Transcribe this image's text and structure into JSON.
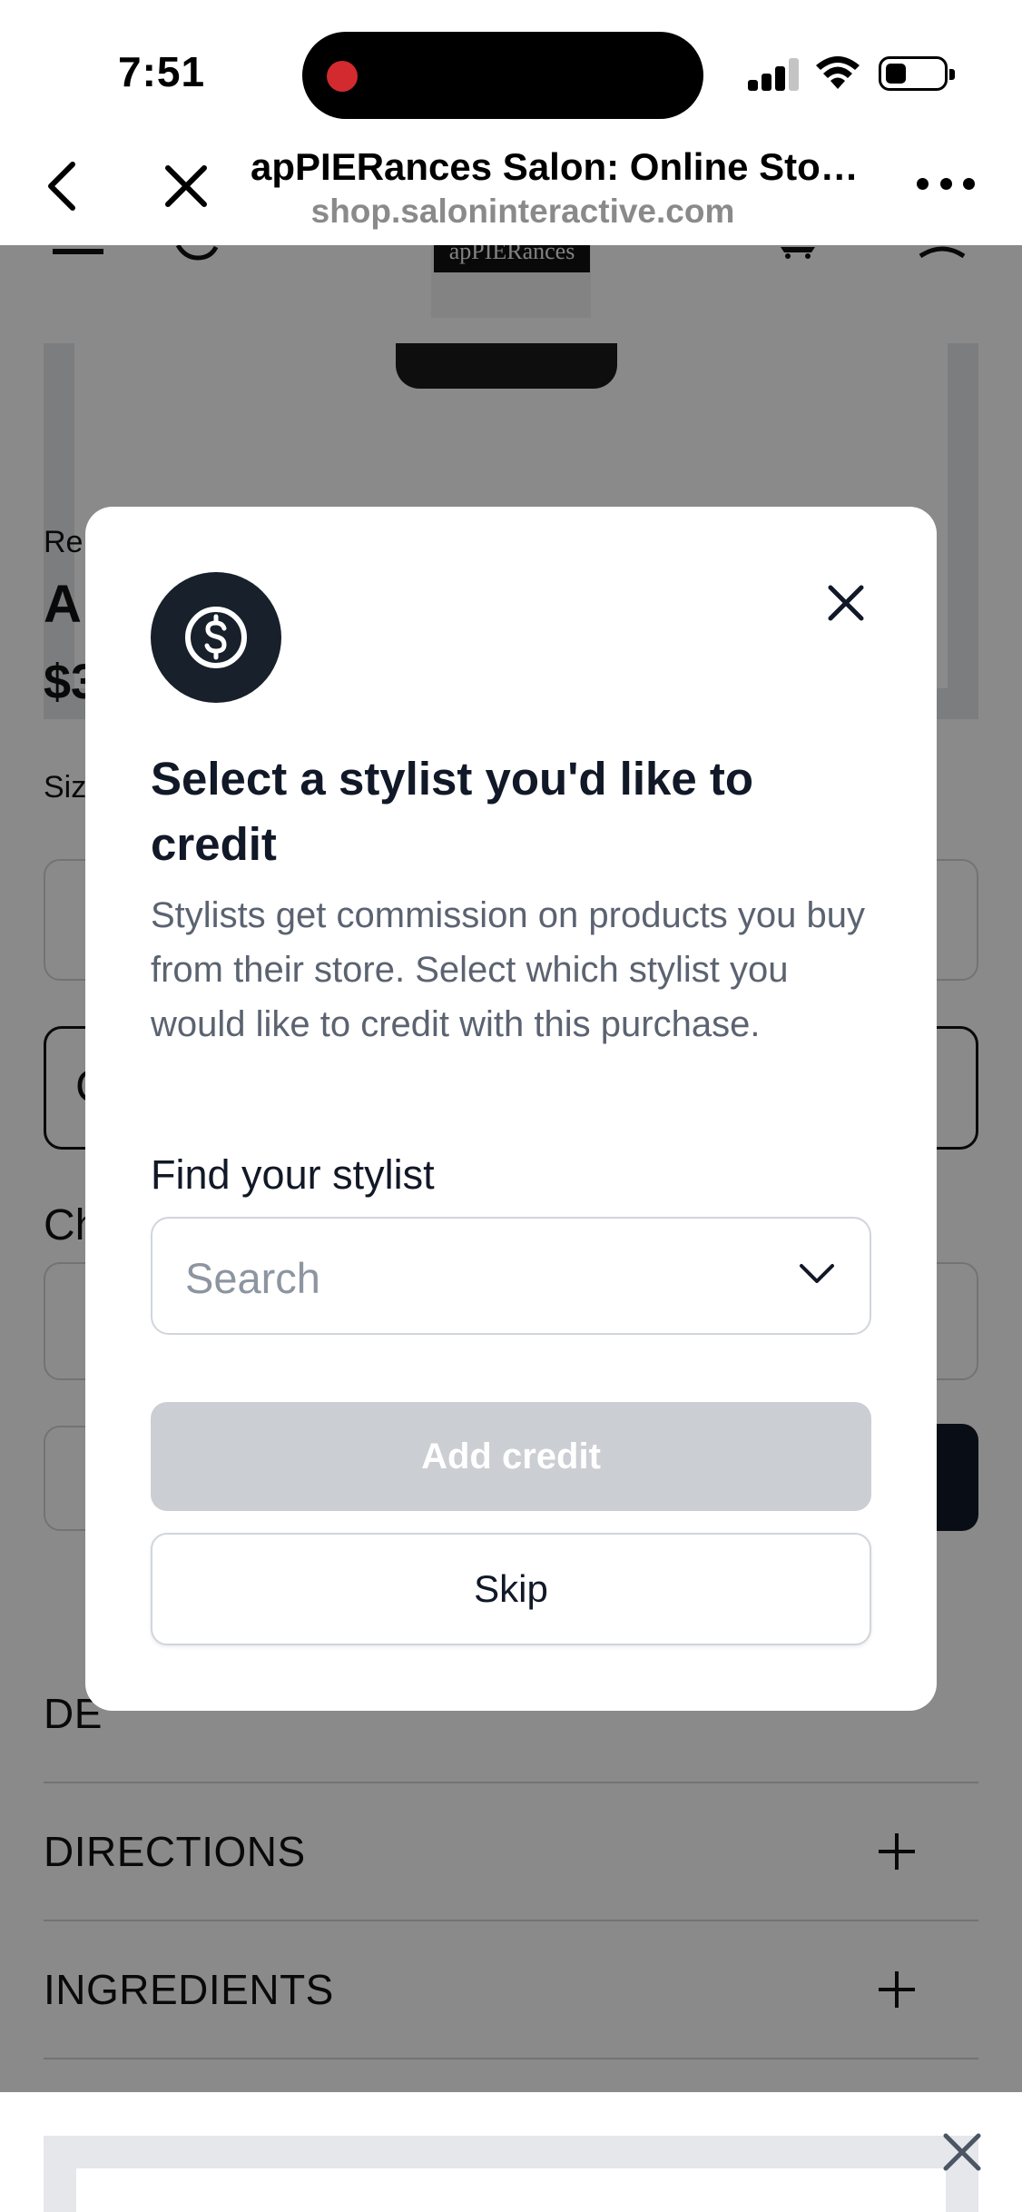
{
  "status_bar": {
    "time": "7:51"
  },
  "browser": {
    "title": "apPIERances Salon: Online Sto…",
    "url": "shop.saloninteractive.com",
    "back_icon": "chevron-left-icon",
    "close_icon": "close-icon",
    "more_icon": "more-horizontal-icon"
  },
  "site": {
    "logo_text": "apPIERances",
    "breadcrumb": "Re",
    "product_title": "A",
    "price": "$3",
    "size_label": "Siz",
    "option_label": "C",
    "choose_label": "Ch",
    "accordion": [
      {
        "label": "DE"
      },
      {
        "label": "DIRECTIONS"
      },
      {
        "label": "INGREDIENTS"
      }
    ]
  },
  "modal": {
    "icon": "dollar-circle-icon",
    "title": "Select a stylist you'd like to credit",
    "description": "Stylists get commission on products you buy from their store. Select which stylist you would like to credit with this purchase.",
    "field_label": "Find your stylist",
    "search_placeholder": "Search",
    "add_button": "Add credit",
    "skip_button": "Skip"
  },
  "colors": {
    "overlay": "#000000",
    "modal_icon_bg": "#17202b",
    "disabled_button": "#cbced2",
    "recording_dot": "#d22a2f"
  }
}
